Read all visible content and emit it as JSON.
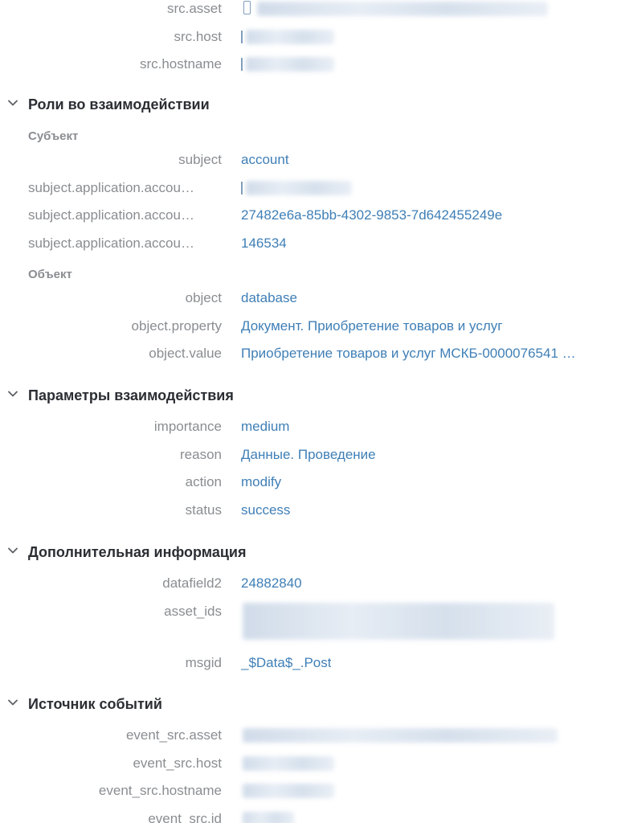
{
  "src": {
    "rows": [
      {
        "key": "src.asset"
      },
      {
        "key": "src.host"
      },
      {
        "key": "src.hostname"
      }
    ]
  },
  "roles": {
    "title": "Роли во взаимодействии",
    "subject_heading": "Субъект",
    "subject_rows": [
      {
        "key": "subject",
        "value": "account"
      },
      {
        "key": "subject.application.accou…"
      },
      {
        "key": "subject.application.accou…",
        "value": "27482e6a-85bb-4302-9853-7d642455249e"
      },
      {
        "key": "subject.application.accou…",
        "value": "146534"
      }
    ],
    "object_heading": "Объект",
    "object_rows": [
      {
        "key": "object",
        "value": "database"
      },
      {
        "key": "object.property",
        "value": "Документ. Приобретение товаров и услуг"
      },
      {
        "key": "object.value",
        "value": "Приобретение товаров и услуг МСКБ-0000076541 …"
      }
    ]
  },
  "params": {
    "title": "Параметры взаимодействия",
    "rows": [
      {
        "key": "importance",
        "value": "medium"
      },
      {
        "key": "reason",
        "value": "Данные. Проведение"
      },
      {
        "key": "action",
        "value": "modify"
      },
      {
        "key": "status",
        "value": "success"
      }
    ]
  },
  "extra": {
    "title": "Дополнительная информация",
    "rows": [
      {
        "key": "datafield2",
        "value": "24882840"
      },
      {
        "key": "asset_ids"
      },
      {
        "key": "msgid",
        "value": "_$Data$_.Post"
      }
    ]
  },
  "event_src": {
    "title": "Источник событий",
    "rows": [
      {
        "key": "event_src.asset"
      },
      {
        "key": "event_src.host"
      },
      {
        "key": "event_src.hostname"
      },
      {
        "key": "event_src.id"
      }
    ]
  },
  "colors": {
    "key": "#8a8d91",
    "value": "#3f7fb6",
    "title": "#2b2e33"
  },
  "icons": {
    "section_toggle": "chevron-down-icon",
    "asset": "device-icon"
  }
}
